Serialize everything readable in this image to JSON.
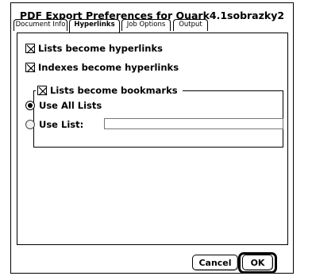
{
  "dialog": {
    "title": "PDF Export Preferences for Quark4.1sobrazky2"
  },
  "tabs": [
    {
      "label": "Document Info",
      "active": false
    },
    {
      "label": "Hyperlinks",
      "active": true
    },
    {
      "label": "Job Options",
      "active": false
    },
    {
      "label": "Output",
      "active": false
    }
  ],
  "options": {
    "lists_hyperlinks": {
      "label": "Lists become hyperlinks",
      "checked": true
    },
    "indexes_hyperlinks": {
      "label": "Indexes become hyperlinks",
      "checked": true
    },
    "lists_bookmarks": {
      "label": "Lists become bookmarks",
      "checked": true
    },
    "use_all_lists": {
      "label": "Use All Lists",
      "selected": true
    },
    "use_list": {
      "label": "Use List:",
      "selected": false,
      "value": ""
    }
  },
  "buttons": {
    "cancel": "Cancel",
    "ok": "OK"
  }
}
